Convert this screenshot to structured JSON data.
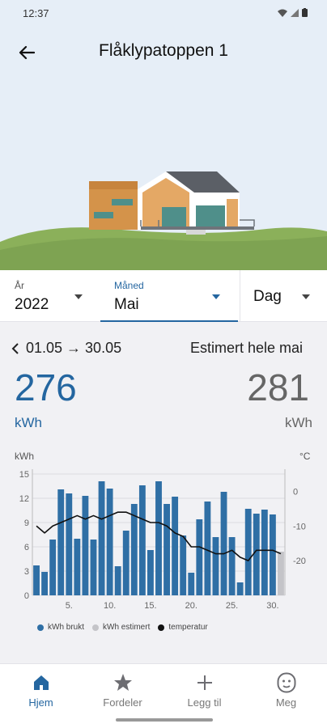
{
  "status": {
    "time": "12:37"
  },
  "header": {
    "title": "Flåklypatoppen 1",
    "back_icon": "arrow-left-icon"
  },
  "period": {
    "year": {
      "caption": "År",
      "value": "2022"
    },
    "month": {
      "caption": "Måned",
      "value": "Mai"
    },
    "day": {
      "value": "Dag"
    }
  },
  "stats": {
    "range_label": "01.05 → 30.05",
    "estimate_label": "Estimert hele mai",
    "used_value": "276",
    "used_unit": "kWh",
    "estimate_value": "281",
    "estimate_unit": "kWh"
  },
  "legend": {
    "used": "kWh brukt",
    "estimated": "kWh estimert",
    "temperature": "temperatur"
  },
  "colors": {
    "accent": "#2466a0",
    "bar": "#2f6fa5",
    "bar_estimated": "#c4c4c8",
    "temperature": "#111111"
  },
  "chart_data": {
    "type": "bar",
    "left_unit_label": "kWh",
    "right_unit_label": "°C",
    "ylim": [
      0,
      15
    ],
    "y_ticks": [
      "0",
      "3",
      "6",
      "9",
      "12",
      "15"
    ],
    "y2lim": [
      -30,
      5
    ],
    "y2_ticks": [
      "0",
      "-10",
      "-20"
    ],
    "x_ticks": [
      "5.",
      "10.",
      "15.",
      "20.",
      "25.",
      "30."
    ],
    "grid": true,
    "legend_placement": "bottom",
    "series": [
      {
        "name": "kWh brukt",
        "values": [
          3.7,
          2.9,
          6.9,
          13.1,
          12.6,
          7.0,
          12.3,
          6.9,
          14.1,
          13.2,
          3.6,
          8.0,
          11.3,
          13.6,
          5.6,
          14.1,
          11.3,
          12.2,
          7.4,
          2.8,
          9.4,
          11.6,
          7.2,
          12.8,
          7.2,
          1.6,
          10.7,
          10.1,
          10.6,
          10.0
        ],
        "x": [
          1,
          2,
          3,
          4,
          5,
          6,
          7,
          8,
          9,
          10,
          11,
          12,
          13,
          14,
          15,
          16,
          17,
          18,
          19,
          20,
          21,
          22,
          23,
          24,
          25,
          26,
          27,
          28,
          29,
          30
        ]
      },
      {
        "name": "kWh estimert",
        "values": [
          5.4
        ],
        "x": [
          31
        ]
      },
      {
        "name": "temperatur",
        "values": [
          -10,
          -12,
          -10,
          -9,
          -8,
          -7,
          -8,
          -7,
          -8,
          -7,
          -6,
          -6,
          -7,
          -8,
          -9,
          -9,
          -10,
          -12,
          -13,
          -16,
          -16,
          -17,
          -18,
          -18,
          -17,
          -19,
          -20,
          -17,
          -17,
          -17,
          -18
        ],
        "x": [
          1,
          2,
          3,
          4,
          5,
          6,
          7,
          8,
          9,
          10,
          11,
          12,
          13,
          14,
          15,
          16,
          17,
          18,
          19,
          20,
          21,
          22,
          23,
          24,
          25,
          26,
          27,
          28,
          29,
          30,
          31
        ]
      }
    ]
  },
  "nav": [
    {
      "label": "Hjem",
      "icon": "home-icon",
      "active": true
    },
    {
      "label": "Fordeler",
      "icon": "star-icon",
      "active": false
    },
    {
      "label": "Legg til",
      "icon": "plus-icon",
      "active": false
    },
    {
      "label": "Meg",
      "icon": "face-icon",
      "active": false
    }
  ]
}
